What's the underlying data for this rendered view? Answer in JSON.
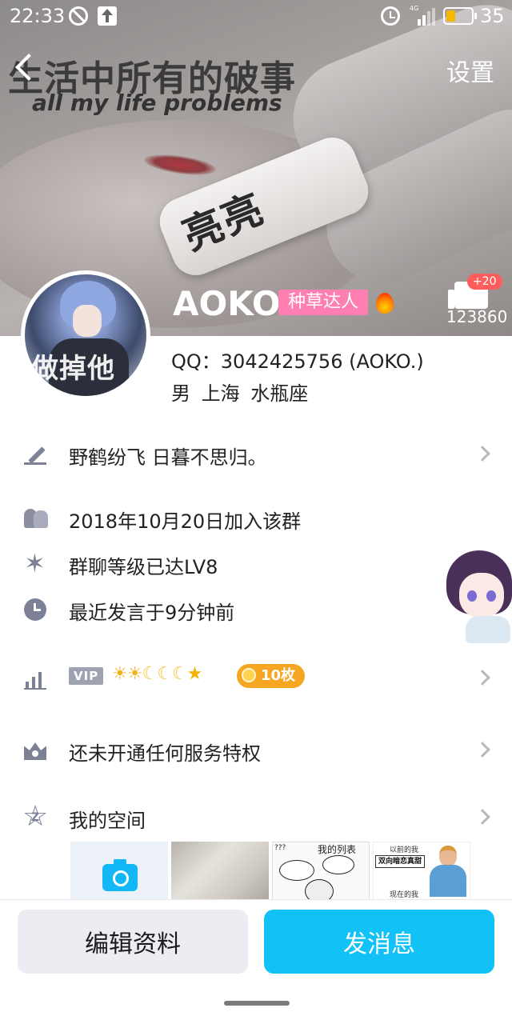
{
  "status_bar": {
    "time": "22:33",
    "network": "4G",
    "battery": "35",
    "battery_level": 0.35
  },
  "header": {
    "back_icon": "chevron-left-icon",
    "settings_label": "设置"
  },
  "cover": {
    "meme_text_cn": "生活中所有的破事",
    "meme_text_en": "all my life problems",
    "bandage_text": "亮亮"
  },
  "profile": {
    "avatar_text": "做掉他",
    "nickname": "AOKO.",
    "badge": "种草达人",
    "badge_color": "#ff7fb3",
    "like_plus": "+20",
    "like_count": "123860",
    "qq_line": "QQ：3042425756 (AOKO.)",
    "meta_line": "男  上海  水瓶座"
  },
  "rows": {
    "signature": "野鹤纷飞 日暮不思归。",
    "joined": "2018年10月20日加入该群",
    "level": "群聊等级已达LV8",
    "last_speak": "最近发言于9分钟前",
    "vip_label": "VIP",
    "coin_count": "10枚",
    "service": "还未开通任何服务特权",
    "zone": "我的空间"
  },
  "photos": {
    "meme_title": "我的列表",
    "meme_q": "???",
    "before_label": "以前的我",
    "box_label": "双向暗恋真甜",
    "now_label": "现在的我"
  },
  "actions": {
    "edit_label": "编辑资料",
    "send_label": "发消息",
    "send_color": "#12c1f5"
  }
}
